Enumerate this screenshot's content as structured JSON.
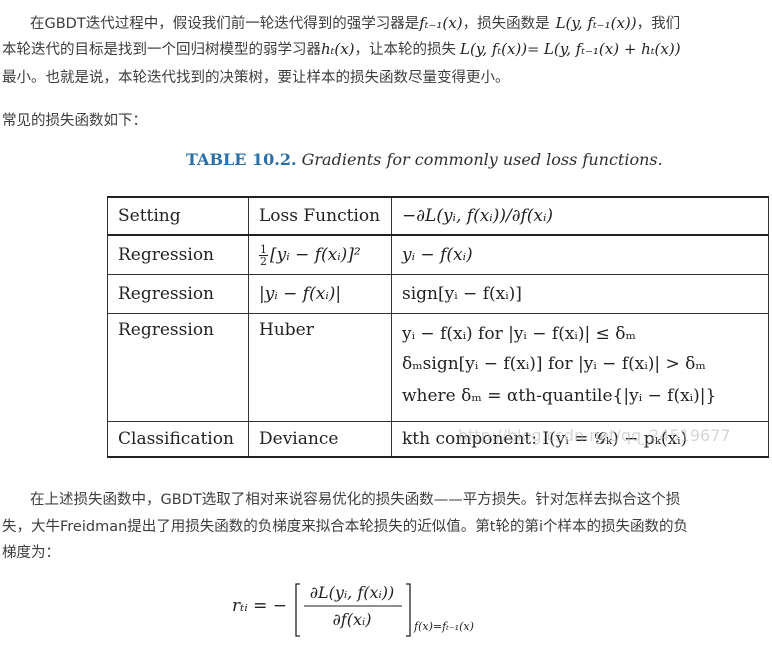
{
  "para1": {
    "line1_prefix": "在GBDT迭代过程中，假设我们前一轮迭代得到的强学习器是",
    "line1_m1": "fₜ₋₁(x)",
    "line1_mid": "，损失函数是",
    "line1_m2": "L(y, fₜ₋₁(x))",
    "line1_suffix": "，我们",
    "line2_prefix": "本轮迭代的目标是找到一个回归树模型的弱学习器",
    "line2_m1": "hₜ(x)",
    "line2_mid": "，让本轮的损失",
    "line2_m2": "L(y, fₜ(x))",
    "line2_eq": "= ",
    "line2_m3": "L(y, fₜ₋₁(x) + hₜ(x))",
    "line3": "最小。也就是说，本轮迭代找到的决策树，要让样本的损失函数尽量变得更小。"
  },
  "para2": "常见的损失函数如下：",
  "caption": {
    "label": "TABLE 10.2.",
    "text": "Gradients for commonly used loss functions."
  },
  "table": {
    "headers": [
      "Setting",
      "Loss Function",
      "−∂L(yᵢ, f(xᵢ))/∂f(xᵢ)"
    ],
    "rows": [
      {
        "setting": "Regression",
        "loss_frac_num": "1",
        "loss_frac_den": "2",
        "loss": "[yᵢ − f(xᵢ)]²",
        "gradient": [
          "yᵢ − f(xᵢ)"
        ]
      },
      {
        "setting": "Regression",
        "loss": "|yᵢ − f(xᵢ)|",
        "gradient": [
          "sign[yᵢ − f(xᵢ)]"
        ]
      },
      {
        "setting": "Regression",
        "loss": "Huber",
        "gradient": [
          "yᵢ − f(xᵢ) for |yᵢ − f(xᵢ)| ≤ δₘ",
          "δₘsign[yᵢ − f(xᵢ)] for |yᵢ − f(xᵢ)| > δₘ",
          "where δₘ = αth-quantile{|yᵢ − f(xᵢ)|}"
        ]
      },
      {
        "setting": "Classification",
        "loss": "Deviance",
        "gradient": [
          "kth component: I(yᵢ = 𝒢ₖ) − pₖ(xᵢ)"
        ]
      }
    ]
  },
  "watermark": "http://blog.csdn.net/qq_24519677",
  "para3": {
    "line1": "在上述损失函数中，GBDT选取了相对来说容易优化的损失函数——平方损失。针对怎样去拟合这个损",
    "line2": "失，大牛Freidman提出了用损失函数的负梯度来拟合本轮损失的近似值。第t轮的第i个样本的损失函数的负",
    "line3": "梯度为："
  },
  "equation": {
    "lhs": "rₜᵢ = −",
    "num": "∂L(yᵢ, f(xᵢ))",
    "den": "∂f(xᵢ)",
    "subscript": "f(x)=fₜ₋₁(x)"
  }
}
